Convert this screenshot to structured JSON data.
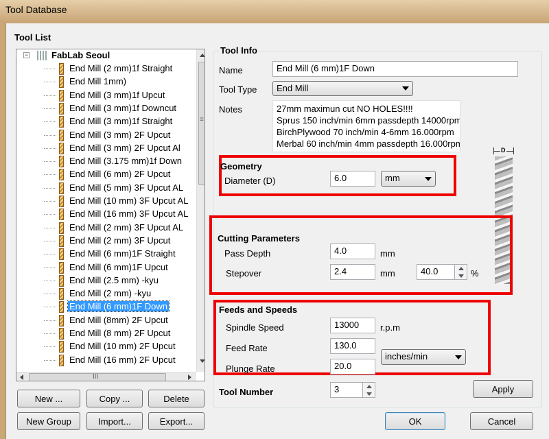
{
  "window": {
    "title": "Tool Database"
  },
  "tool_list": {
    "label": "Tool List",
    "root": "FabLab Seoul",
    "items": [
      "End Mill (2 mm)1f Straight",
      "End Mill 1mm)",
      "End Mill (3 mm)1f Upcut",
      "End Mill (3 mm)1f Downcut",
      "End Mill (3 mm)1f Straight",
      "End Mill (3 mm) 2F Upcut",
      "End Mill (3 mm) 2F Upcut Al",
      "End Mill (3.175 mm)1f Down",
      "End Mill (6 mm) 2F Upcut",
      "End Mill (5 mm) 3F Upcut AL",
      "End Mill (10 mm) 3F Upcut AL",
      "End Mill (16 mm) 3F Upcut AL",
      "End Mill (2 mm) 3F Upcut AL",
      "End Mill (2 mm) 3F Upcut",
      "End Mill (6 mm)1F Straight",
      "End Mill (6 mm)1F Upcut",
      "End Mill (2.5 mm) -kyu",
      "End Mill (2 mm) -kyu",
      "End Mill (6 mm)1F Down",
      "End Mill (8mm) 2F Upcut",
      "End Mill (8 mm) 2F Upcut",
      "End Mill (10 mm) 2F Upcut",
      "End Mill (16 mm) 2F Upcut"
    ],
    "selected_index": 18,
    "hscroll_grip": "III",
    "vscroll_grip": "≡"
  },
  "list_buttons": {
    "new": "New ...",
    "copy": "Copy ...",
    "delete": "Delete",
    "new_group": "New Group",
    "import": "Import...",
    "export": "Export..."
  },
  "tool_info": {
    "label": "Tool Info",
    "name_label": "Name",
    "name_value": "End Mill (6 mm)1F Down",
    "type_label": "Tool Type",
    "type_value": "End Mill",
    "notes_label": "Notes",
    "notes_lines": [
      "27mm maximun cut NO HOLES!!!!",
      "Sprus 150 inch/min 6mm passdepth 14000rpm",
      "BirchPlywood 70 inch/min 4-6mm 16.000rpm",
      "Merbal 60 inch/min 4mm passdepth 16.000rpm"
    ],
    "diagram_label": "D"
  },
  "geometry": {
    "label": "Geometry",
    "diameter_label": "Diameter (D)",
    "diameter_value": "6.0",
    "unit_value": "mm"
  },
  "cutting": {
    "label": "Cutting Parameters",
    "pass_depth_label": "Pass Depth",
    "pass_depth_value": "4.0",
    "pass_depth_unit": "mm",
    "stepover_label": "Stepover",
    "stepover_value": "2.4",
    "stepover_unit": "mm",
    "stepover_percent": "40.0",
    "percent_sign": "%"
  },
  "feeds": {
    "label": "Feeds and Speeds",
    "spindle_label": "Spindle Speed",
    "spindle_value": "13000",
    "spindle_unit": "r.p.m",
    "feed_label": "Feed Rate",
    "feed_value": "130.0",
    "plunge_label": "Plunge Rate",
    "plunge_value": "20.0",
    "rate_unit": "inches/min"
  },
  "tool_number": {
    "label": "Tool Number",
    "value": "3"
  },
  "buttons": {
    "apply": "Apply",
    "ok": "OK",
    "cancel": "Cancel"
  },
  "colors": {
    "highlight": "#ee0000",
    "selection": "#3399ff",
    "window_frame": "#c9a876"
  }
}
